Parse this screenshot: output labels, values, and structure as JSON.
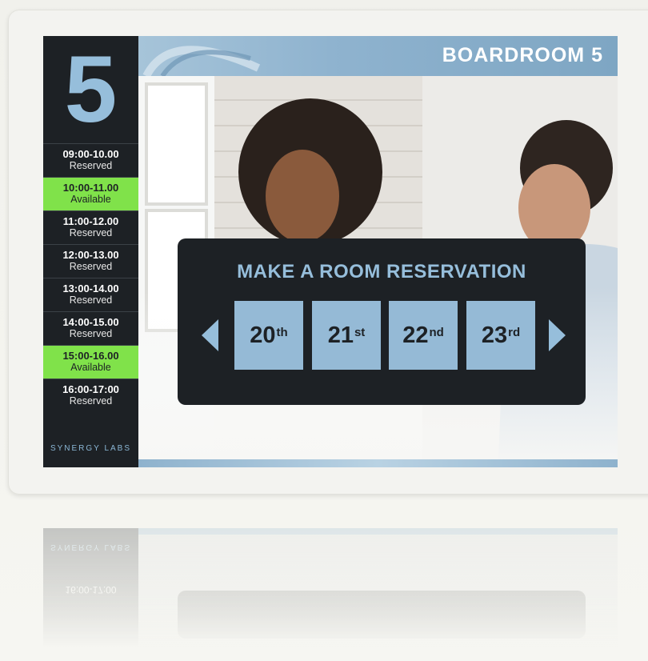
{
  "room": {
    "number": "5",
    "title": "BOARDROOM 5"
  },
  "schedule": [
    {
      "time": "09:00-10.00",
      "status": "Reserved"
    },
    {
      "time": "10:00-11.00",
      "status": "Available"
    },
    {
      "time": "11:00-12.00",
      "status": "Reserved"
    },
    {
      "time": "12:00-13.00",
      "status": "Reserved"
    },
    {
      "time": "13:00-14.00",
      "status": "Reserved"
    },
    {
      "time": "14:00-15.00",
      "status": "Reserved"
    },
    {
      "time": "15:00-16.00",
      "status": "Available"
    },
    {
      "time": "16:00-17:00",
      "status": "Reserved"
    }
  ],
  "brand": "SYNERGY LABS",
  "reservation": {
    "title": "MAKE A ROOM RESERVATION",
    "dates": [
      {
        "day": "20",
        "suffix": "th"
      },
      {
        "day": "21",
        "suffix": "st"
      },
      {
        "day": "22",
        "suffix": "nd"
      },
      {
        "day": "23",
        "suffix": "rd"
      }
    ],
    "prev_icon": "triangle-left-icon",
    "next_icon": "triangle-right-icon"
  },
  "colors": {
    "panel": "#1d2125",
    "accent_blue": "#96bedb",
    "available_green": "#80e24a",
    "date_button": "#95bad6"
  }
}
